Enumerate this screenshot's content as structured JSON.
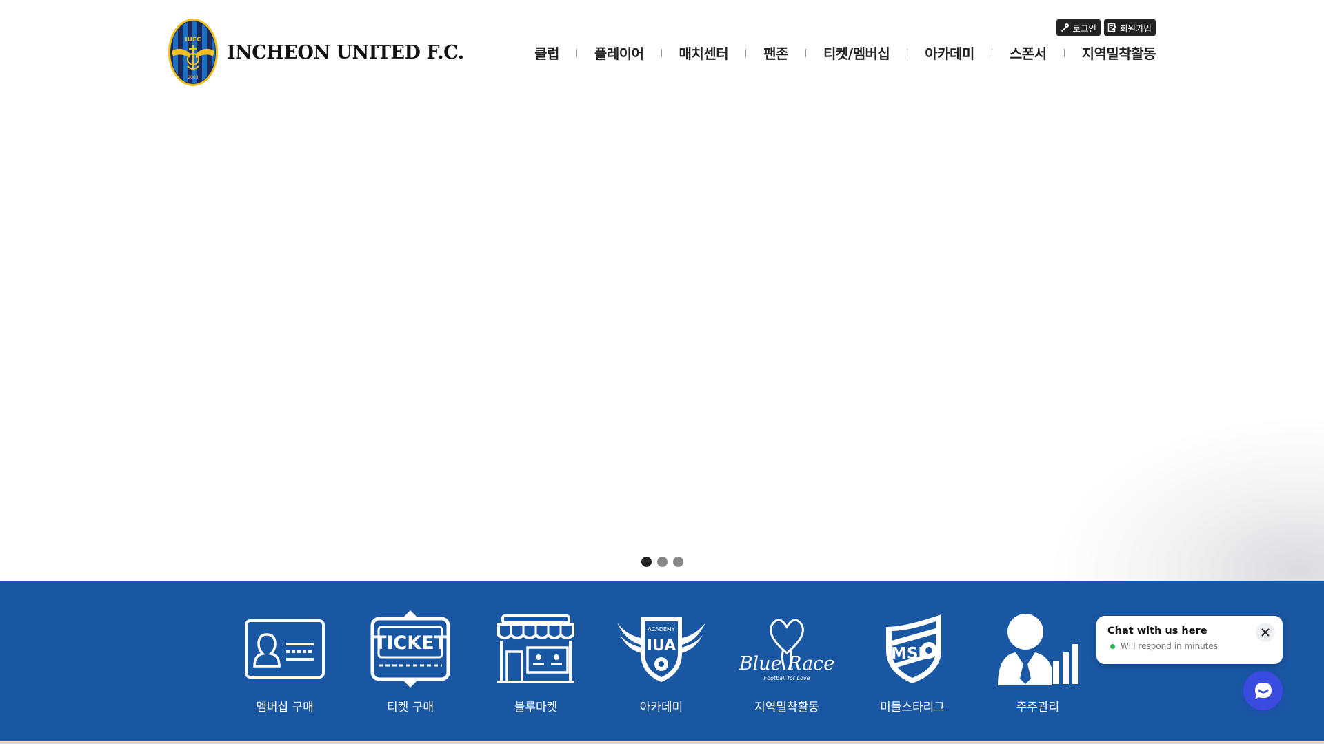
{
  "header": {
    "logo_text": "INCHEON UNITED F.C.",
    "logo_badge_top": "IUFC",
    "logo_badge_year": "2003",
    "utils": [
      {
        "label": "로그인",
        "icon": "key-icon"
      },
      {
        "label": "회원가입",
        "icon": "edit-document-icon"
      }
    ],
    "nav": [
      "클럽",
      "플레이어",
      "매치센터",
      "팬존",
      "티켓/멤버십",
      "아카데미",
      "스폰서",
      "지역밀착활동"
    ]
  },
  "hero": {
    "slides_total": 3,
    "active_slide": 1
  },
  "quick_menu": [
    {
      "label": "멤버십 구매",
      "icon": "membership-card-icon"
    },
    {
      "label": "티켓 구매",
      "icon": "ticket-icon",
      "icon_text": "TICKET"
    },
    {
      "label": "블루마켓",
      "icon": "store-icon"
    },
    {
      "label": "아카데미",
      "icon": "academy-emblem-icon",
      "icon_text_top": "ACADEMY",
      "icon_text_main": "IUA"
    },
    {
      "label": "지역밀착활동",
      "icon": "blue-race-logo-icon",
      "icon_text_main": "Blue Race",
      "icon_text_sub": "Football for Love"
    },
    {
      "label": "미들스타리그",
      "icon": "msl-emblem-icon",
      "icon_text_main": "MSL"
    },
    {
      "label": "주주관리",
      "icon": "shareholder-icon"
    }
  ],
  "chat": {
    "title": "Chat with us here",
    "status": "Will respond in minutes",
    "colors": {
      "launcher": "#3a4be0",
      "online": "#2bb24c"
    }
  },
  "colors": {
    "brand_blue": "#1a57a3",
    "logo_gold": "#f2c01e",
    "logo_navy": "#1a2b5c"
  }
}
